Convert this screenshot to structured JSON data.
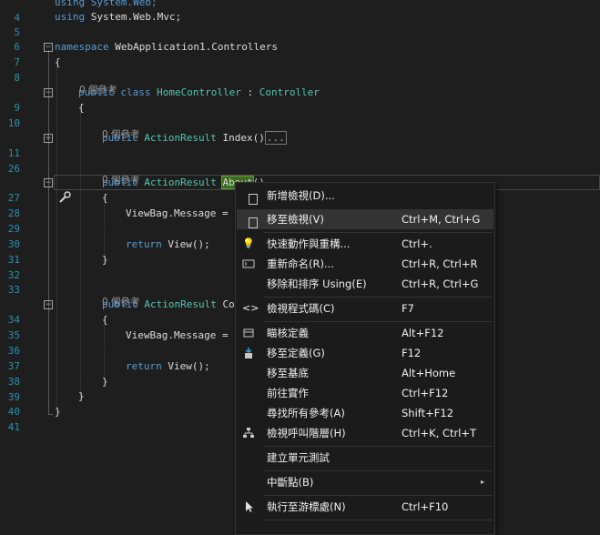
{
  "editor": {
    "codelens_text": "0 個參考",
    "lines": [
      {
        "n": "4",
        "text": "using System.Web;"
      },
      {
        "n": "5",
        "text": "using System.Web.Mvc;"
      },
      {
        "n": "6",
        "text": ""
      },
      {
        "n": "7",
        "text_kw": "namespace",
        "text": " WebApplication1.Controllers"
      },
      {
        "n": "8",
        "text": "{"
      },
      {
        "n": "9",
        "kw": "public class",
        "type1": "HomeController",
        "mid": " : ",
        "type2": "Controller"
      },
      {
        "n": "10",
        "text": "{"
      },
      {
        "n": "11",
        "kw": "public",
        "type": "ActionResult",
        "rest": " Index()",
        "ellipsis": "..."
      },
      {
        "n": "26",
        "text": ""
      },
      {
        "n": "27",
        "kw": "public",
        "type": "ActionResult",
        "hl": "About",
        "rest": "()"
      },
      {
        "n": "28",
        "text": "{"
      },
      {
        "n": "29",
        "text": "ViewBag.Message = \""
      },
      {
        "n": "30",
        "text": ""
      },
      {
        "n": "31",
        "kw": "return",
        "rest": " View();"
      },
      {
        "n": "32",
        "text": "}"
      },
      {
        "n": "33",
        "text": ""
      },
      {
        "n": "34",
        "kw": "public",
        "type": "ActionResult",
        "rest": " Con"
      },
      {
        "n": "35",
        "text": "{"
      },
      {
        "n": "36",
        "text": "ViewBag.Message = \""
      },
      {
        "n": "37",
        "text": ""
      },
      {
        "n": "38",
        "kw": "return",
        "rest": " View();"
      },
      {
        "n": "39",
        "text": "}"
      },
      {
        "n": "40",
        "text": "}"
      },
      {
        "n": "41",
        "text": "}"
      }
    ]
  },
  "context_menu": {
    "items": [
      {
        "label": "新增檢視(D)...",
        "shortcut": "",
        "icon": "add-view-icon"
      },
      {
        "label": "移至檢視(V)",
        "shortcut": "Ctrl+M, Ctrl+G",
        "icon": "go-to-view-icon"
      },
      {
        "label": "快速動作與重構...",
        "shortcut": "Ctrl+.",
        "icon": "lightbulb-icon"
      },
      {
        "label": "重新命名(R)...",
        "shortcut": "Ctrl+R, Ctrl+R",
        "icon": "rename-icon"
      },
      {
        "label": "移除和排序 Using(E)",
        "shortcut": "Ctrl+R, Ctrl+G",
        "icon": ""
      },
      {
        "label": "檢視程式碼(C)",
        "shortcut": "F7",
        "icon": "code-icon"
      },
      {
        "label": "瞄核定義",
        "shortcut": "Alt+F12",
        "icon": "peek-definition-icon"
      },
      {
        "label": "移至定義(G)",
        "shortcut": "F12",
        "icon": "go-to-definition-icon"
      },
      {
        "label": "移至基底",
        "shortcut": "Alt+Home",
        "icon": ""
      },
      {
        "label": "前往實作",
        "shortcut": "Ctrl+F12",
        "icon": ""
      },
      {
        "label": "尋找所有參考(A)",
        "shortcut": "Shift+F12",
        "icon": ""
      },
      {
        "label": "檢視呼叫階層(H)",
        "shortcut": "Ctrl+K, Ctrl+T",
        "icon": "call-hierarchy-icon"
      },
      {
        "label": "建立單元測試",
        "shortcut": "",
        "icon": ""
      },
      {
        "label": "中斷點(B)",
        "shortcut": "",
        "icon": "",
        "submenu": "▸"
      },
      {
        "label": "執行至游標處(N)",
        "shortcut": "Ctrl+F10",
        "icon": "cursor-icon"
      }
    ]
  },
  "colors": {
    "background": "#1e1e1e",
    "keyword": "#569cd6",
    "type": "#4ec9b0",
    "line_number": "#2b91af",
    "menu_bg": "#1b1b1c",
    "menu_hover": "#333334"
  }
}
